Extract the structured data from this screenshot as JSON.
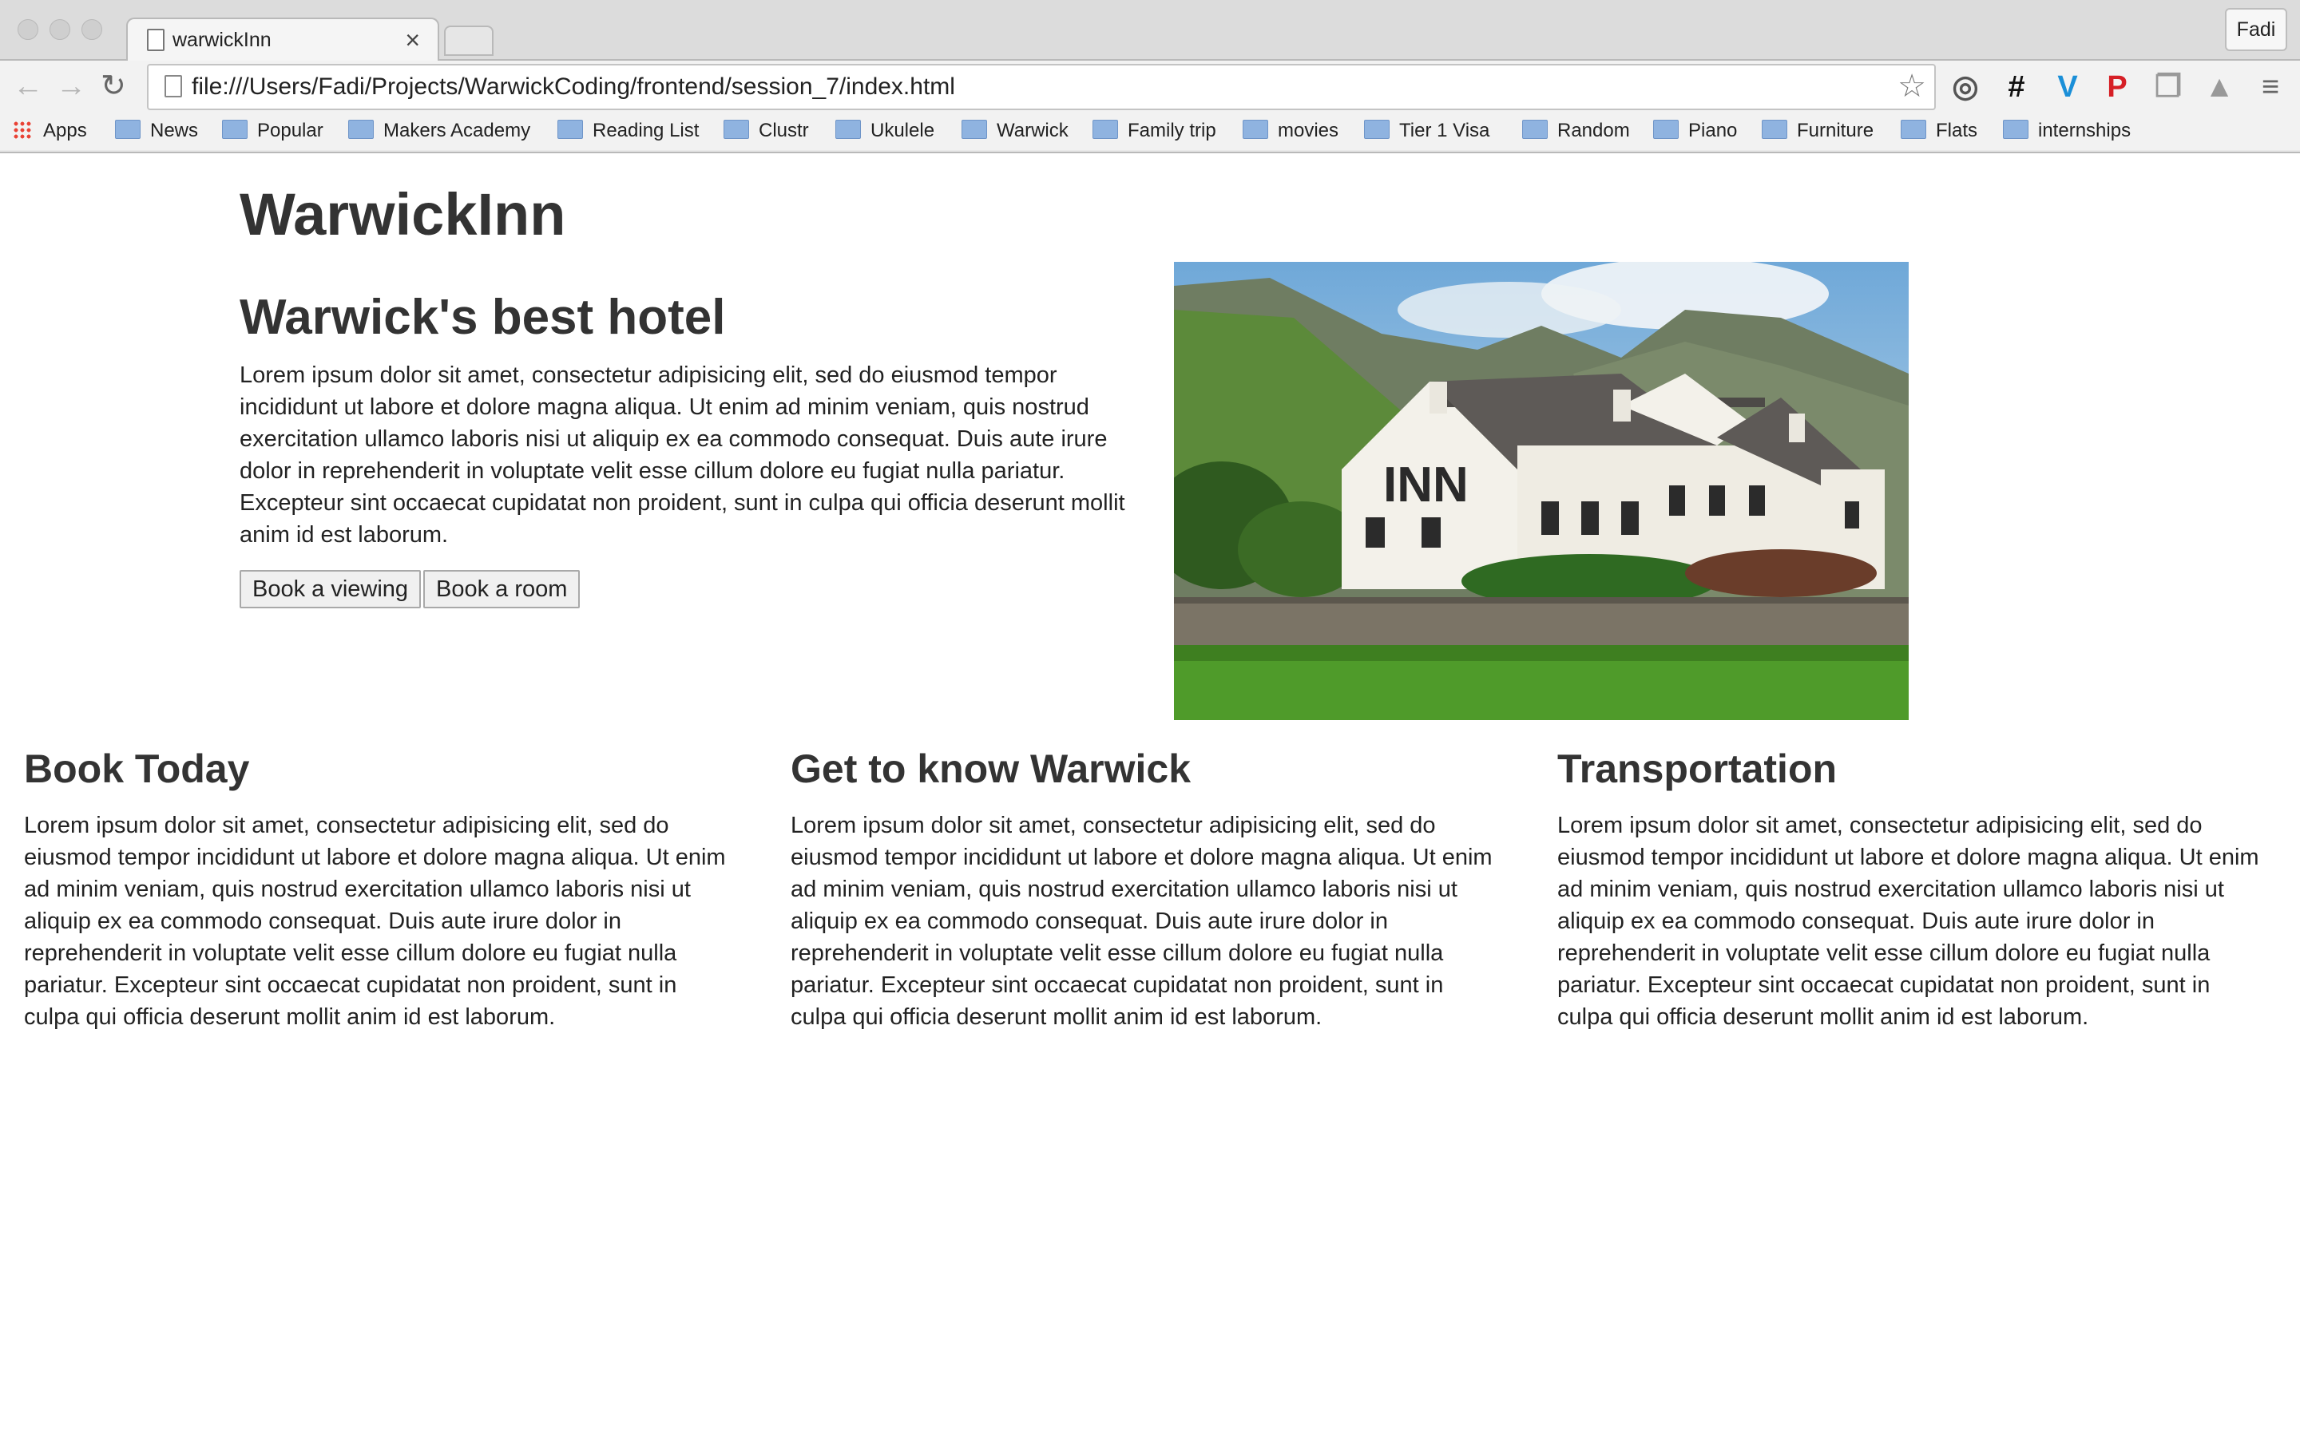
{
  "browser": {
    "tab_title": "warwickInn",
    "profile": "Fadi",
    "url": "file:///Users/Fadi/Projects/WarwickCoding/frontend/session_7/index.html",
    "bookmarks": [
      "Apps",
      "News",
      "Popular",
      "Makers Academy",
      "Reading List",
      "Clustr",
      "Ukulele",
      "Warwick",
      "Family trip",
      "movies",
      "Tier 1 Visa",
      "Random",
      "Piano",
      "Furniture",
      "Flats",
      "internships"
    ],
    "extensions": [
      "opera-icon",
      "hashtag-icon",
      "vimeo-icon",
      "pinterest-icon",
      "copy-icon",
      "drive-icon",
      "menu-icon"
    ]
  },
  "page": {
    "title": "WarwickInn",
    "hero": {
      "heading": "Warwick's best hotel",
      "text": "Lorem ipsum dolor sit amet, consectetur adipisicing elit, sed do eiusmod tempor incididunt ut labore et dolore magna aliqua. Ut enim ad minim veniam, quis nostrud exercitation ullamco laboris nisi ut aliquip ex ea commodo consequat. Duis aute irure dolor in reprehenderit in voluptate velit esse cillum dolore eu fugiat nulla pariatur. Excepteur sint occaecat cupidatat non proident, sunt in culpa qui officia deserunt mollit anim id est laborum.",
      "button_viewing": "Book a viewing",
      "button_room": "Book a room",
      "image_sign": "INN"
    },
    "columns": [
      {
        "heading": "Book Today",
        "text": "Lorem ipsum dolor sit amet, consectetur adipisicing elit, sed do eiusmod tempor incididunt ut labore et dolore magna aliqua. Ut enim ad minim veniam, quis nostrud exercitation ullamco laboris nisi ut aliquip ex ea commodo consequat. Duis aute irure dolor in reprehenderit in voluptate velit esse cillum dolore eu fugiat nulla pariatur. Excepteur sint occaecat cupidatat non proident, sunt in culpa qui officia deserunt mollit anim id est laborum."
      },
      {
        "heading": "Get to know Warwick",
        "text": "Lorem ipsum dolor sit amet, consectetur adipisicing elit, sed do eiusmod tempor incididunt ut labore et dolore magna aliqua. Ut enim ad minim veniam, quis nostrud exercitation ullamco laboris nisi ut aliquip ex ea commodo consequat. Duis aute irure dolor in reprehenderit in voluptate velit esse cillum dolore eu fugiat nulla pariatur. Excepteur sint occaecat cupidatat non proident, sunt in culpa qui officia deserunt mollit anim id est laborum."
      },
      {
        "heading": "Transportation",
        "text": "Lorem ipsum dolor sit amet, consectetur adipisicing elit, sed do eiusmod tempor incididunt ut labore et dolore magna aliqua. Ut enim ad minim veniam, quis nostrud exercitation ullamco laboris nisi ut aliquip ex ea commodo consequat. Duis aute irure dolor in reprehenderit in voluptate velit esse cillum dolore eu fugiat nulla pariatur. Excepteur sint occaecat cupidatat non proident, sunt in culpa qui officia deserunt mollit anim id est laborum."
      }
    ]
  }
}
